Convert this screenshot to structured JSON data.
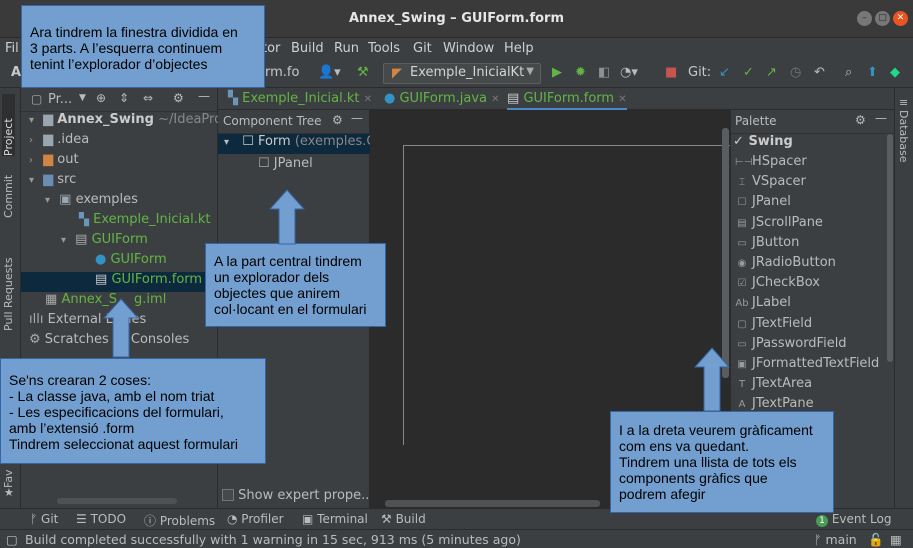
{
  "window": {
    "title": "Annex_Swing – GUIForm.form"
  },
  "menu": {
    "items": [
      {
        "text": "Fil"
      },
      {
        "text": "tor"
      },
      {
        "text": "Build"
      },
      {
        "text": "Run"
      },
      {
        "text": "Tools"
      },
      {
        "text": "Git"
      },
      {
        "text": "Window"
      },
      {
        "text": "Help"
      }
    ]
  },
  "toolbar": {
    "crumb_left": "A",
    "crumb_file": "rm.fo",
    "run_config": "Exemple_InicialKt",
    "git_label": "Git:"
  },
  "project_panel": {
    "header": "Pr...",
    "tree": [
      {
        "text": "Annex_Swing",
        "extra": "~/IdeaProjec"
      },
      {
        "text": ".idea"
      },
      {
        "text": "out"
      },
      {
        "text": "src"
      },
      {
        "text": "exemples"
      },
      {
        "text": "Exemple_Inicial.kt"
      },
      {
        "text": "GUIForm"
      },
      {
        "text": "GUIForm"
      },
      {
        "text": "GUIForm.form"
      },
      {
        "text": "Annex_S",
        "extra": "g.iml"
      },
      {
        "text": "External Li",
        "extra": "ries"
      },
      {
        "text": "Scratches a",
        "extra": "Consoles"
      }
    ]
  },
  "left_strip": {
    "tabs": [
      "Project",
      "Commit",
      "Pull Requests",
      "Fav"
    ]
  },
  "editor_tabs": [
    {
      "label": "Exemple_Inicial.kt"
    },
    {
      "label": "GUIForm.java"
    },
    {
      "label": "GUIForm.form"
    }
  ],
  "component_tree": {
    "header": "Component Tree",
    "rows": [
      {
        "text": "Form",
        "extra": "(exemples.G"
      },
      {
        "text": "JPanel"
      }
    ],
    "footer": "Show expert prope..."
  },
  "palette": {
    "header": "Palette",
    "group": "Swing",
    "items": [
      {
        "icon": "⊢⊣",
        "label": "HSpacer"
      },
      {
        "icon": "⌶",
        "label": "VSpacer"
      },
      {
        "icon": "☐",
        "label": "JPanel"
      },
      {
        "icon": "▤",
        "label": "JScrollPane"
      },
      {
        "icon": "▭",
        "label": "JButton"
      },
      {
        "icon": "◉",
        "label": "JRadioButton"
      },
      {
        "icon": "☑",
        "label": "JCheckBox"
      },
      {
        "icon": "Ab",
        "label": "JLabel"
      },
      {
        "icon": "▢",
        "label": "JTextField"
      },
      {
        "icon": "▭",
        "label": "JPasswordField"
      },
      {
        "icon": "▣",
        "label": "JFormattedTextField"
      },
      {
        "icon": "T",
        "label": "JTextArea"
      },
      {
        "icon": "A",
        "label": "JTextPane"
      }
    ]
  },
  "right_strip": {
    "label": "Database"
  },
  "bottom_tools": [
    {
      "label": "Git"
    },
    {
      "label": "TODO"
    },
    {
      "label": "Problems"
    },
    {
      "label": "Profiler"
    },
    {
      "label": "Terminal"
    },
    {
      "label": "Build"
    },
    {
      "label": "Event Log",
      "badge": "1"
    }
  ],
  "status": {
    "message": "Build completed successfully with 1 warning in 15 sec, 913 ms (5 minutes ago)",
    "branch": "main"
  },
  "callouts": {
    "top_left": [
      "Ara tindrem  la finestra dividida en",
      "3 parts. A l’esquerra continuem",
      "tenint l’explorador d’objectes"
    ],
    "center": [
      "A la part central tindrem",
      "un explorador dels",
      "objectes que anirem",
      "col·locant en el formulari"
    ],
    "bottom_left": [
      "Se'ns crearan 2 coses:",
      "- La classe java, amb el nom triat",
      "- Les especificacions del formulari,",
      "amb l’extensió .form",
      "Tindrem seleccionat aquest formulari"
    ],
    "right": [
      "I a la dreta veurem gràficament",
      "com ens va quedant.",
      "Tindrem una llista de tots els",
      "components gràfics que",
      "podrem afegir"
    ]
  },
  "colors": {
    "accent": "#4a88c7",
    "callout": "#729fcf",
    "selection": "#0d293e"
  }
}
